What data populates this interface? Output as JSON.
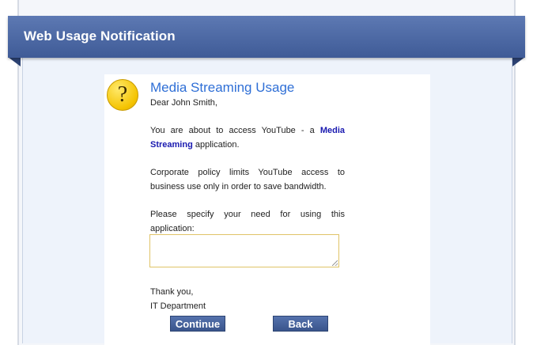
{
  "header": {
    "title": "Web Usage Notification"
  },
  "notice": {
    "icon": "question-mark-icon",
    "icon_glyph": "?",
    "heading": "Media Streaming Usage",
    "greeting": "Dear John Smith,",
    "para1_prefix": "You are about to access YouTube - a ",
    "para1_bold": "Media Streaming",
    "para1_suffix": " application.",
    "para2": "Corporate policy limits YouTube access to business use only in order to save bandwidth.",
    "para3": "Please specify your need for using this application:",
    "reason_value": "",
    "thanks": "Thank you,",
    "signature": "IT Department"
  },
  "buttons": {
    "continue_label": "Continue",
    "back_label": "Back"
  },
  "colors": {
    "header": "#4a66a1",
    "heading": "#2f6fd6",
    "button": "#465f99",
    "icon": "#f4c300"
  }
}
